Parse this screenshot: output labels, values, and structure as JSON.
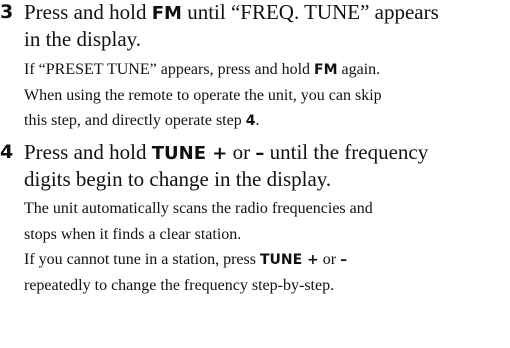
{
  "steps": [
    {
      "number": "3",
      "main": {
        "line1": {
          "pre": "Press and hold ",
          "key": "FM",
          "post": " until “FREQ. TUNE” appears"
        },
        "line2": "in the display."
      },
      "sub": {
        "line1": {
          "pre": "If “PRESET TUNE” appears, press and hold ",
          "key": "FM",
          "post": " again."
        },
        "line2": "When using the remote to operate the unit, you can skip",
        "line3": {
          "pre": "this step, and directly operate step ",
          "key": "4",
          "post": "."
        }
      }
    },
    {
      "number": "4",
      "main": {
        "line1": {
          "pre": "Press and hold ",
          "key1": "TUNE +",
          "mid": " or ",
          "key2": "–",
          "post": " until the frequency"
        },
        "line2": "digits begin to change in the display."
      },
      "sub": {
        "line1": "The unit automatically scans the radio frequencies and",
        "line2": "stops when it finds a clear station.",
        "line3": {
          "pre": "If you cannot tune in a station, press ",
          "key1": "TUNE +",
          "mid": " or ",
          "key2": "–"
        },
        "line4": "repeatedly to change the frequency step-by-step."
      }
    }
  ]
}
